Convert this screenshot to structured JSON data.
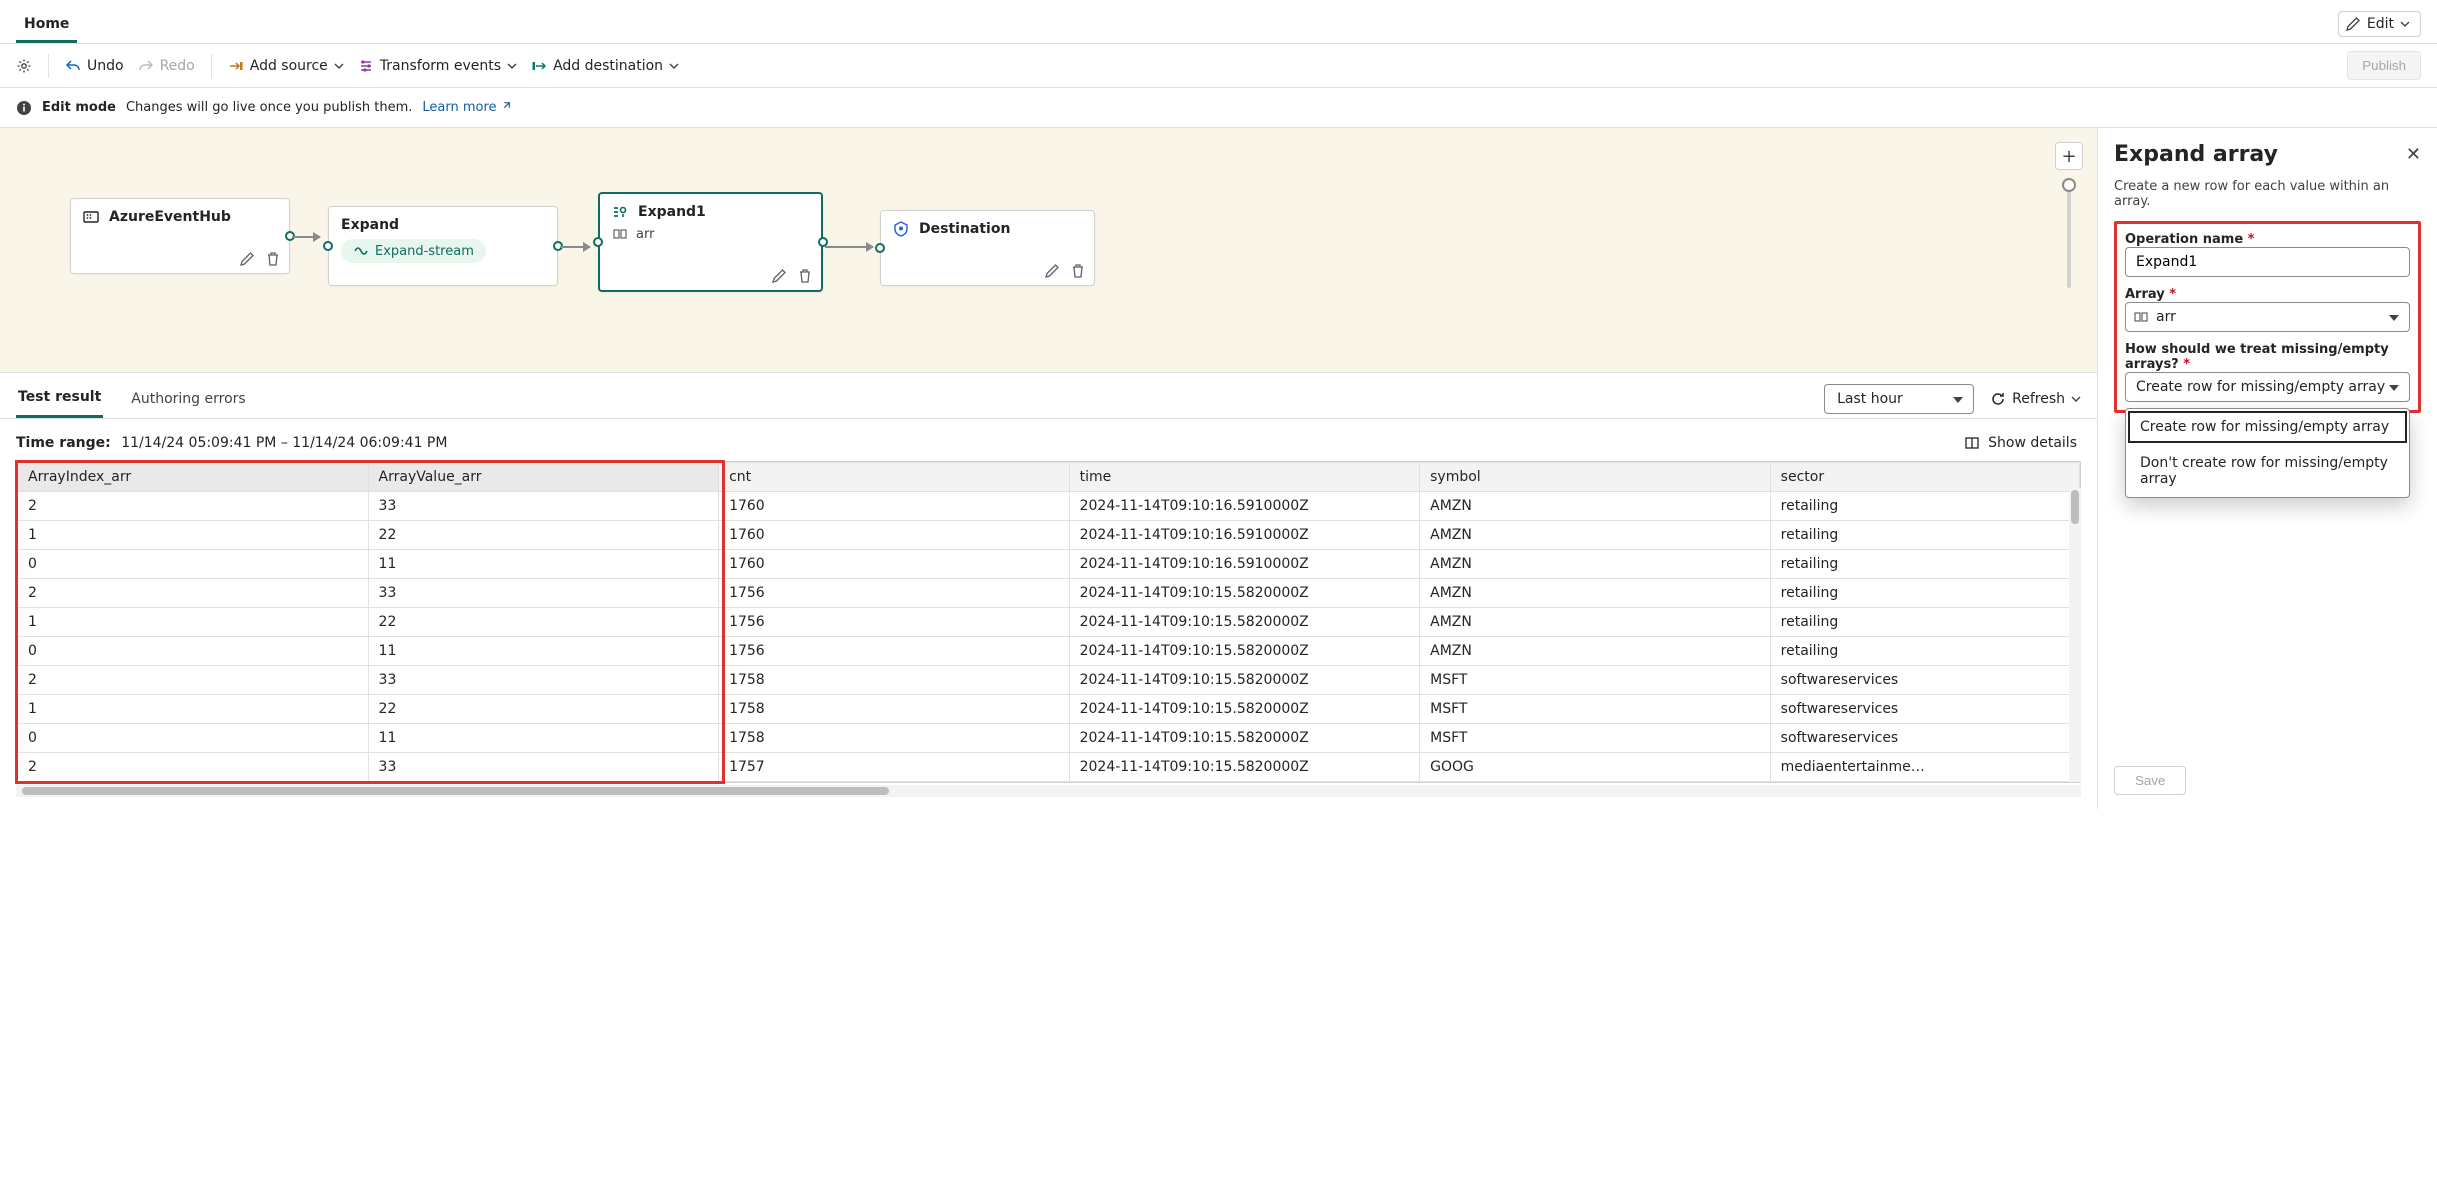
{
  "header": {
    "tab": "Home",
    "edit": "Edit"
  },
  "toolbar": {
    "undo": "Undo",
    "redo": "Redo",
    "addSource": "Add source",
    "transform": "Transform events",
    "addDest": "Add destination",
    "publish": "Publish"
  },
  "infoBar": {
    "mode": "Edit mode",
    "msg": "Changes will go live once you publish them.",
    "learn": "Learn more"
  },
  "canvas": {
    "nodes": {
      "source": {
        "title": "AzureEventHub"
      },
      "expand": {
        "title": "Expand",
        "pill": "Expand-stream"
      },
      "expand1": {
        "title": "Expand1",
        "sub": "arr"
      },
      "dest": {
        "title": "Destination"
      }
    }
  },
  "resultsTabs": {
    "test": "Test result",
    "errors": "Authoring errors",
    "range": "Last hour",
    "refresh": "Refresh"
  },
  "meta": {
    "label": "Time range:",
    "value": "11/14/24 05:09:41 PM – 11/14/24 06:09:41 PM",
    "details": "Show details"
  },
  "grid": {
    "columns": [
      "ArrayIndex_arr",
      "ArrayValue_arr",
      "cnt",
      "time",
      "symbol",
      "sector"
    ],
    "rows": [
      [
        "2",
        "33",
        "1760",
        "2024-11-14T09:10:16.5910000Z",
        "AMZN",
        "retailing"
      ],
      [
        "1",
        "22",
        "1760",
        "2024-11-14T09:10:16.5910000Z",
        "AMZN",
        "retailing"
      ],
      [
        "0",
        "11",
        "1760",
        "2024-11-14T09:10:16.5910000Z",
        "AMZN",
        "retailing"
      ],
      [
        "2",
        "33",
        "1756",
        "2024-11-14T09:10:15.5820000Z",
        "AMZN",
        "retailing"
      ],
      [
        "1",
        "22",
        "1756",
        "2024-11-14T09:10:15.5820000Z",
        "AMZN",
        "retailing"
      ],
      [
        "0",
        "11",
        "1756",
        "2024-11-14T09:10:15.5820000Z",
        "AMZN",
        "retailing"
      ],
      [
        "2",
        "33",
        "1758",
        "2024-11-14T09:10:15.5820000Z",
        "MSFT",
        "softwareservices"
      ],
      [
        "1",
        "22",
        "1758",
        "2024-11-14T09:10:15.5820000Z",
        "MSFT",
        "softwareservices"
      ],
      [
        "0",
        "11",
        "1758",
        "2024-11-14T09:10:15.5820000Z",
        "MSFT",
        "softwareservices"
      ],
      [
        "2",
        "33",
        "1757",
        "2024-11-14T09:10:15.5820000Z",
        "GOOG",
        "mediaentertainme…"
      ]
    ]
  },
  "side": {
    "title": "Expand array",
    "desc": "Create a new row for each value within an array.",
    "opNameLbl": "Operation name",
    "opName": "Expand1",
    "arrayLbl": "Array",
    "array": "arr",
    "missingLbl": "How should we treat missing/empty arrays?",
    "missingSel": "Create row for missing/empty array",
    "opts": [
      "Create row for missing/empty array",
      "Don't create row for missing/empty array"
    ],
    "save": "Save"
  }
}
